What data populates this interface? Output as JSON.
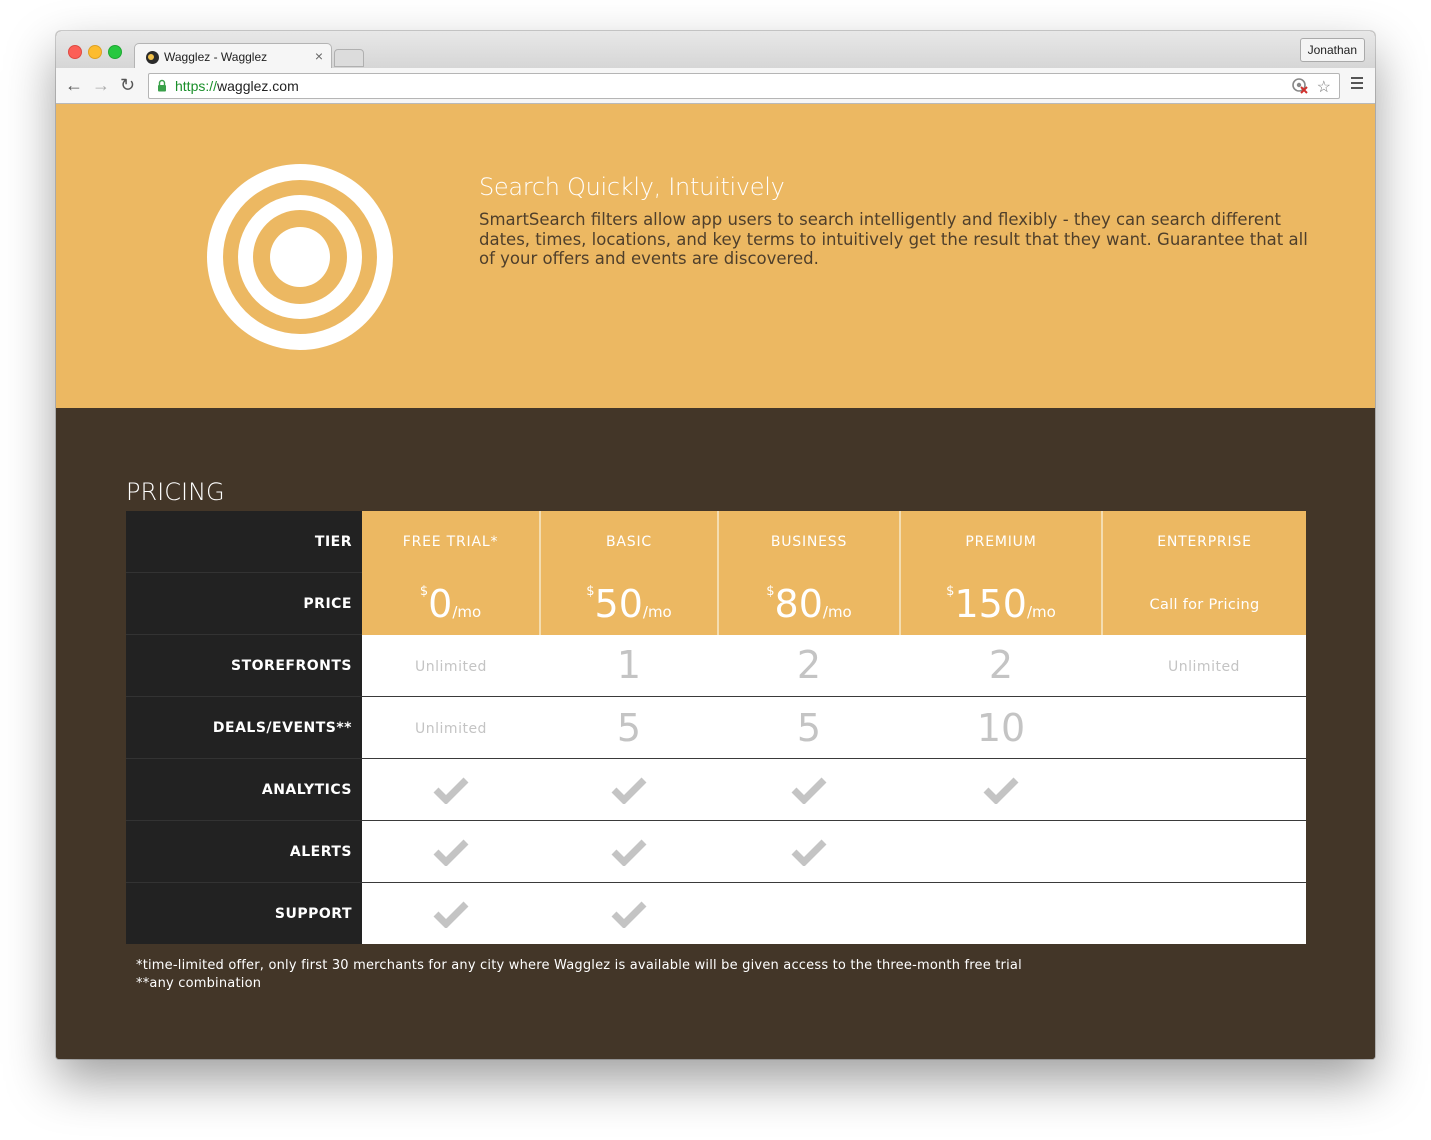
{
  "browser": {
    "tab_title": "Wagglez - Wagglez",
    "tab_close": "×",
    "profile_name": "Jonathan",
    "url_scheme": "https://",
    "url_host": "wagglez.com",
    "icons": [
      "back-arrow-icon",
      "forward-arrow-icon",
      "reload-icon",
      "lock-icon",
      "extension-blocked-icon",
      "star-icon",
      "menu-icon"
    ]
  },
  "hero": {
    "title": "Search Quickly, Intuitively",
    "body": "SmartSearch filters allow app users to search intelligently and flexibly - they can search different dates, times, locations, and key terms to intuitively get the result that they want. Guarantee that all of your offers and events are discovered.",
    "icon": "target-icon"
  },
  "pricing": {
    "title": "PRICING",
    "row_labels": {
      "tier": "TIER",
      "price": "PRICE",
      "storefronts": "STOREFRONTS",
      "deals": "DEALS/EVENTS**",
      "analytics": "ANALYTICS",
      "alerts": "ALERTS",
      "support": "SUPPORT"
    },
    "plans": [
      {
        "tier": "FREE TRIAL*",
        "currency": "$",
        "amount": "0",
        "unit": "/mo",
        "storefronts": "Unlimited",
        "deals": "Unlimited",
        "analytics": true,
        "alerts": true,
        "support": true
      },
      {
        "tier": "BASIC",
        "currency": "$",
        "amount": "50",
        "unit": "/mo",
        "storefronts": "1",
        "deals": "5",
        "analytics": true,
        "alerts": true,
        "support": true
      },
      {
        "tier": "BUSINESS",
        "currency": "$",
        "amount": "80",
        "unit": "/mo",
        "storefronts": "2",
        "deals": "5",
        "analytics": true,
        "alerts": true,
        "support": false
      },
      {
        "tier": "PREMIUM",
        "currency": "$",
        "amount": "150",
        "unit": "/mo",
        "storefronts": "2",
        "deals": "10",
        "analytics": true,
        "alerts": false,
        "support": false
      },
      {
        "tier": "ENTERPRISE",
        "call_text": "Call for Pricing",
        "storefronts": "Unlimited",
        "deals": "",
        "analytics": false,
        "alerts": false,
        "support": false
      }
    ],
    "footnote_1": "*time-limited offer, only first 30 merchants for any city where Wagglez is available will be given access to the three-month free trial",
    "footnote_2": "**any combination"
  },
  "colors": {
    "accent": "#ecb862",
    "dark_bg": "#433628",
    "row_header_bg": "#222222",
    "muted": "#c4c4c4"
  }
}
